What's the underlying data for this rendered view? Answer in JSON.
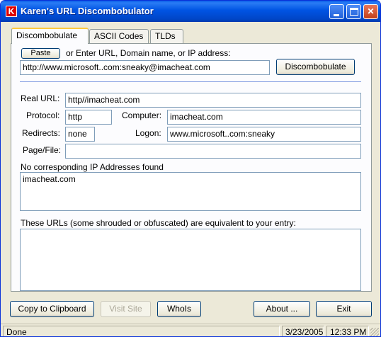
{
  "window": {
    "title": "Karen's URL Discombobulator",
    "icon_letter": "K"
  },
  "tabs": [
    {
      "label": "Discombobulate",
      "active": true
    },
    {
      "label": "ASCII Codes",
      "active": false
    },
    {
      "label": "TLDs",
      "active": false
    }
  ],
  "input": {
    "paste_label": "Paste",
    "prompt": "or Enter URL, Domain name, or IP address:",
    "value": "http://www.microsoft..com:sneaky@imacheat.com",
    "discombobulate_label": "Discombobulate"
  },
  "results": {
    "real_url_label": "Real URL:",
    "real_url": "http//imacheat.com",
    "protocol_label": "Protocol:",
    "protocol": "http",
    "computer_label": "Computer:",
    "computer": "imacheat.com",
    "redirects_label": "Redirects:",
    "redirects": "none",
    "logon_label": "Logon:",
    "logon": "www.microsoft..com:sneaky",
    "pagefile_label": "Page/File:",
    "pagefile": "",
    "ip_label": "No corresponding IP Addresses found",
    "ip_text": "imacheat.com",
    "equiv_label": "These URLs (some shrouded or obfuscated) are equivalent to your entry:",
    "equiv_text": ""
  },
  "buttons": {
    "copy": "Copy to Clipboard",
    "visit": "Visit Site",
    "whois": "WhoIs",
    "about": "About ...",
    "exit": "Exit"
  },
  "status": {
    "text": "Done",
    "date": "3/23/2005",
    "time": "12:33 PM"
  }
}
